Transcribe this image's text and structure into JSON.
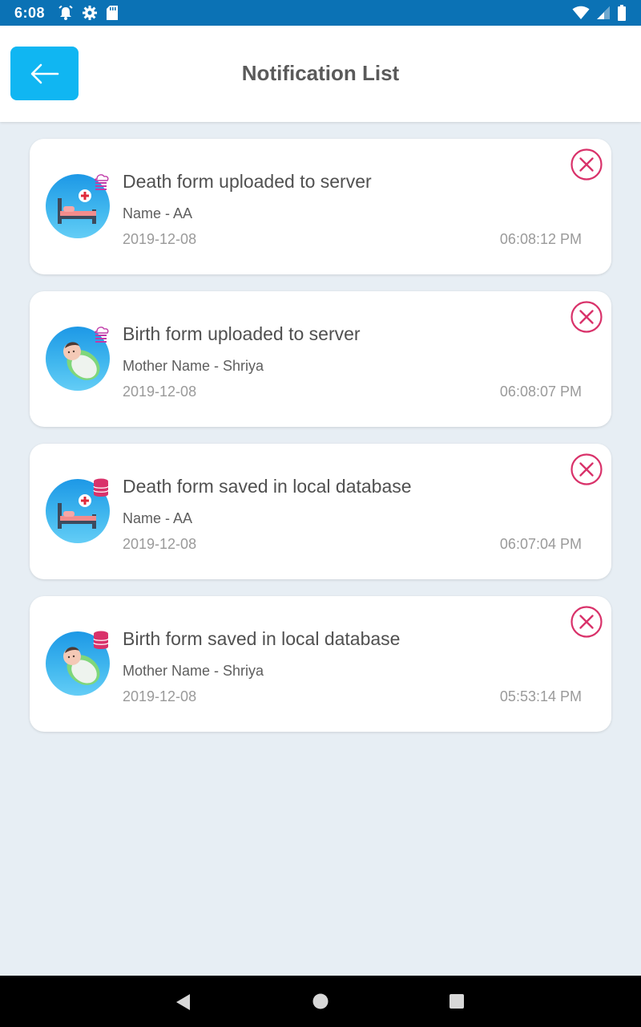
{
  "status_bar": {
    "time": "6:08",
    "icons_left": [
      "alarm-icon",
      "settings-icon",
      "sd-card-icon"
    ],
    "icons_right": [
      "wifi-icon",
      "signal-icon",
      "battery-icon"
    ]
  },
  "header": {
    "title": "Notification List",
    "back_icon": "arrow-left-icon",
    "accent": "#10b6f2"
  },
  "notifications": [
    {
      "title": "Death form uploaded to server",
      "name": "Name - AA",
      "date": "2019-12-08",
      "time": "06:08:12 PM",
      "type": "death",
      "status": "uploaded"
    },
    {
      "title": "Birth form uploaded to server",
      "name": "Mother Name - Shriya",
      "date": "2019-12-08",
      "time": "06:08:07 PM",
      "type": "birth",
      "status": "uploaded"
    },
    {
      "title": "Death form saved in local database",
      "name": "Name - AA",
      "date": "2019-12-08",
      "time": "06:07:04 PM",
      "type": "death",
      "status": "saved"
    },
    {
      "title": "Birth form saved in local database",
      "name": "Mother Name - Shriya",
      "date": "2019-12-08",
      "time": "05:53:14 PM",
      "type": "birth",
      "status": "saved"
    }
  ],
  "colors": {
    "status_bar": "#0b72b5",
    "close_icon": "#d9326a",
    "background": "#e7eef4"
  },
  "nav_bar": {
    "icons": [
      "nav-back-icon",
      "nav-home-icon",
      "nav-recents-icon"
    ]
  }
}
